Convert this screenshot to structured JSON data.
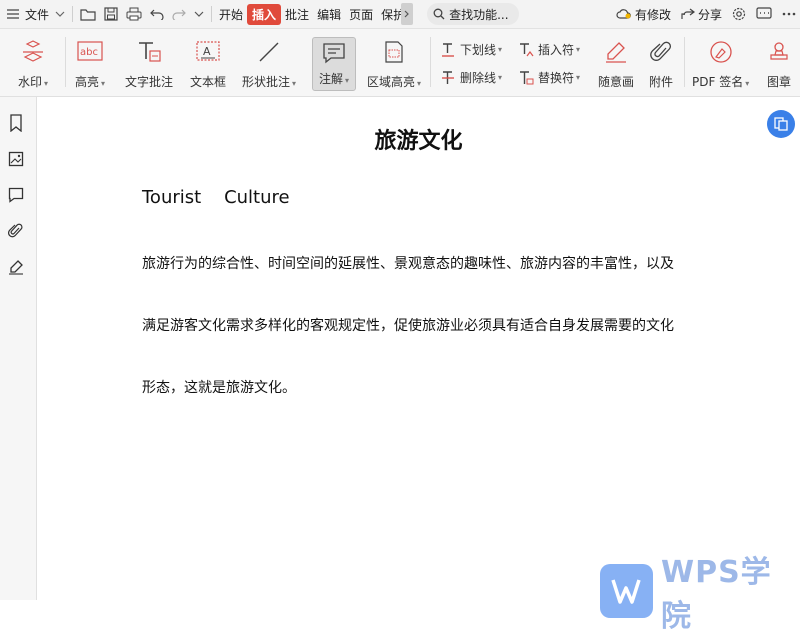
{
  "menubar": {
    "file_label": "文件",
    "tabs": [
      {
        "label": "开始",
        "active": false
      },
      {
        "label": "插入",
        "active": true
      },
      {
        "label": "批注",
        "active": false
      },
      {
        "label": "编辑",
        "active": false
      },
      {
        "label": "页面",
        "active": false
      },
      {
        "label": "保护",
        "active": false
      }
    ],
    "search_label": "查找功能...",
    "modified_label": "有修改",
    "share_label": "分享",
    "active_color": "#e04a3b"
  },
  "toolbar": {
    "watermark": "水印",
    "highlight": "高亮",
    "text_comment": "文字批注",
    "textbox": "文本框",
    "shape_comment": "形状批注",
    "note": "注解",
    "area_highlight": "区域高亮",
    "underline": "下划线",
    "strikethrough": "删除线",
    "insert_symbol": "插入符",
    "replace_symbol": "替换符",
    "freehand": "随意画",
    "attachment": "附件",
    "pdf_sign": "PDF 签名",
    "stamp": "图章"
  },
  "document": {
    "title": "旅游文化",
    "subtitle": "Tourist    Culture",
    "paragraphs": [
      "旅游行为的综合性、时间空间的延展性、景观意态的趣味性、旅游内容的丰富性，以及",
      "满足游客文化需求多样化的客观规定性，促使旅游业必须具有适合自身发展需要的文化",
      "形态，这就是旅游文化。"
    ]
  },
  "watermark_logo": {
    "text": "WPS学院",
    "color": "#5f97f1"
  }
}
